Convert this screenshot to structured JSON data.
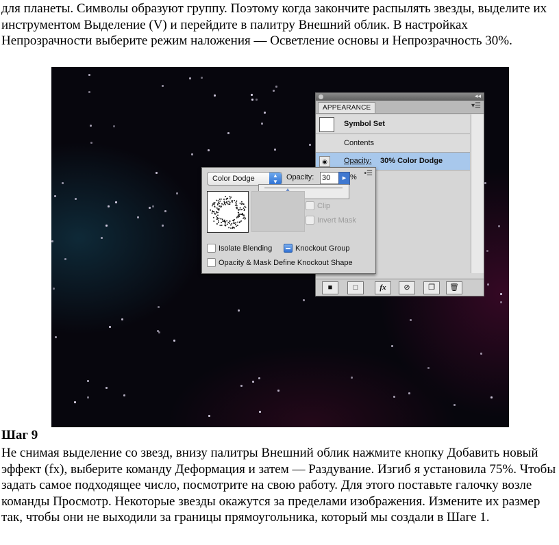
{
  "text": {
    "para_top": "для планеты. Символы образуют группу. Поэтому когда закончите распылять звезды, выделите их инструментом Выделение (V) и перейдите в палитру Внешний облик. В настройках Непрозрачности выберите режим наложения — Осветление основы и Непрозрачность 30%.",
    "step_heading": "Шаг 9",
    "para_bottom": "Не снимая выделение со звезд, внизу палитры Внешний облик нажмите кнопку Добавить новый эффект (fx), выберите команду Деформация и затем — Раздувание. Изгиб я установила 75%. Чтобы задать самое подходящее число, посмотрите на свою работу. Для этого поставьте галочку возле команды Просмотр. Некоторые звезды окажутся за пределами изображения. Измените их размер так, чтобы они не выходили за границы прямоугольника, который мы создали в Шаге 1."
  },
  "appearance_panel": {
    "tab": "APPEARANCE",
    "symbol_set": "Symbol Set",
    "contents": "Contents",
    "opacity_label": "Opacity:",
    "opacity_value": "30% Color Dodge",
    "toolbar_fx": "fx"
  },
  "transparency_popup": {
    "blend_mode": "Color Dodge",
    "opacity_label": "Opacity:",
    "opacity_value": "30",
    "opacity_unit": "%",
    "opacity_percent": 30,
    "clip": "Clip",
    "invert_mask": "Invert Mask",
    "isolate_blending": "Isolate Blending",
    "knockout_group": "Knockout Group",
    "define_knockout": "Opacity & Mask Define Knockout Shape"
  },
  "colors": {
    "canvas_bg": "#07060d",
    "selected_row": "#a8c8ec",
    "accent_blue": "#2c6fd2",
    "star": "#d8d0e6"
  }
}
